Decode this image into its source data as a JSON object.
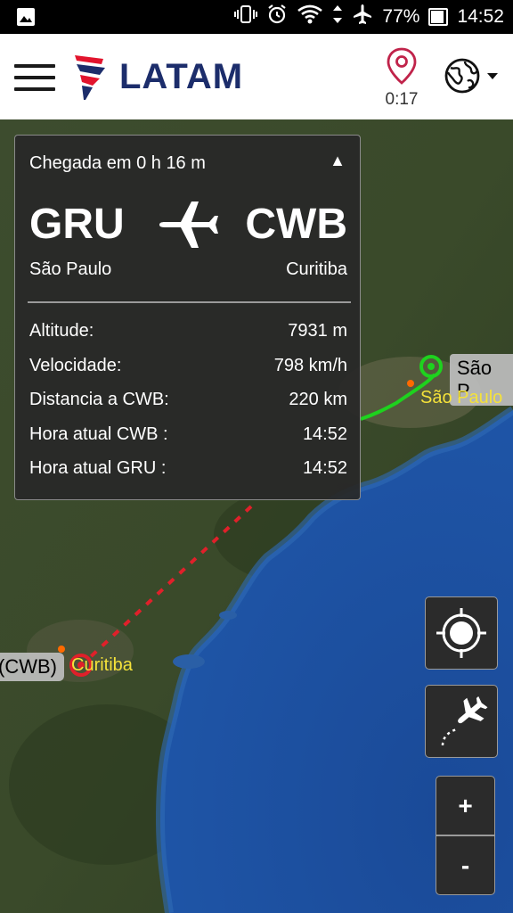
{
  "statusbar": {
    "battery": "77%",
    "time": "14:52",
    "icons": [
      "image-icon",
      "vibrate-icon",
      "alarm-icon",
      "wifi-icon",
      "data-arrows-icon",
      "airplane-mode-icon",
      "battery-icon"
    ]
  },
  "header": {
    "brand": "LATAM",
    "timer": "0:17",
    "colors": {
      "brand_navy": "#1c2d6b",
      "brand_red": "#e2142d",
      "pin": "#c0234a"
    }
  },
  "flight": {
    "arrival_text": "Chegada em 0 h 16 m",
    "from_code": "GRU",
    "to_code": "CWB",
    "from_city": "São Paulo",
    "to_city": "Curitiba",
    "details": [
      {
        "label": "Altitude:",
        "value": "7931 m"
      },
      {
        "label": "Velocidade:",
        "value": "798 km/h"
      },
      {
        "label": "Distancia a CWB:",
        "value": "220 km"
      },
      {
        "label": "Hora atual CWB :",
        "value": "14:52"
      },
      {
        "label": "Hora atual GRU :",
        "value": "14:52"
      }
    ]
  },
  "map": {
    "origin_tag": "São P",
    "origin_city": "São Paulo",
    "dest_tag": "(CWB)",
    "dest_city": "Curitiba",
    "colors": {
      "flown_path": "#1ed21e",
      "remaining_path": "#e0202a",
      "ocean": "#1d4f9e"
    }
  },
  "controls": {
    "zoom_in": "+",
    "zoom_out": "-"
  }
}
